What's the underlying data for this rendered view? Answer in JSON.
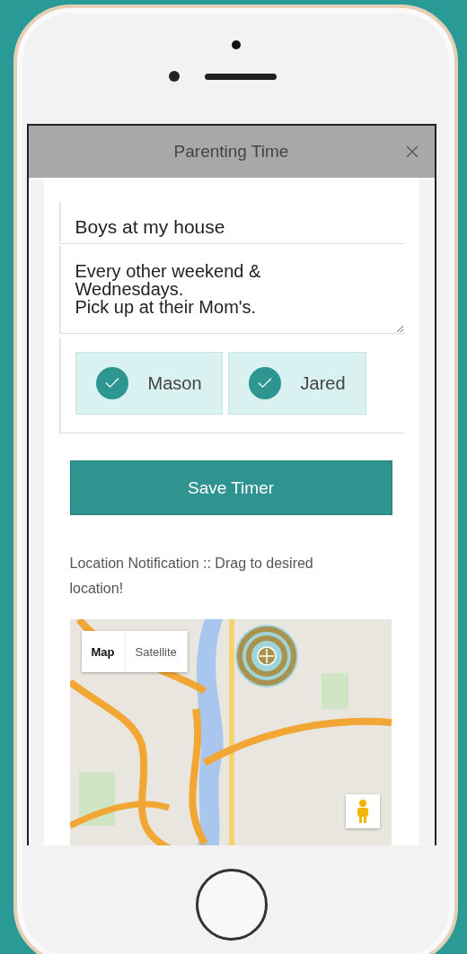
{
  "dialog": {
    "title": "Parenting Time"
  },
  "form": {
    "title_field": {
      "value": "Boys at my house"
    },
    "notes_field": {
      "value": "Every other weekend &\nWednesdays.\nPick up at their Mom's."
    },
    "children": [
      {
        "name": "Mason",
        "checked": true
      },
      {
        "name": "Jared",
        "checked": true
      }
    ],
    "save_button": "Save Timer",
    "location_note": "Location Notification :: Drag to desired location!",
    "map": {
      "map_types": [
        {
          "label": "Map",
          "selected": true
        },
        {
          "label": "Satellite",
          "selected": false
        }
      ]
    }
  }
}
